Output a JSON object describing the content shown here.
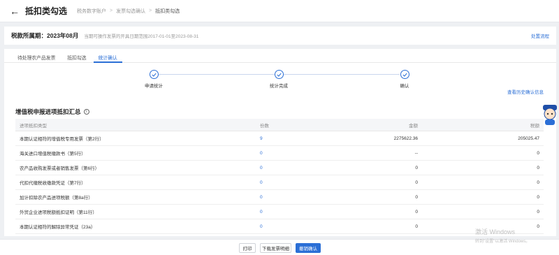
{
  "header": {
    "back_icon": "arrow-left-icon",
    "title": "抵扣类勾选",
    "breadcrumbs": [
      "税务数字账户",
      "发票勾选确认",
      "抵扣类勾选"
    ]
  },
  "period": {
    "label": "税款所属期：",
    "value": "2023年08月",
    "hint": "当期可操作发票的开具日期范围2017-01-01至2023-08-31",
    "link": "处置流程"
  },
  "tabs": [
    "待处理农产品发票",
    "抵扣勾选",
    "统计确认"
  ],
  "active_tab": 2,
  "steps": [
    "申请统计",
    "统计完成",
    "确认"
  ],
  "history_link": "查看历史确认信息",
  "section": {
    "title": "增值税申报进项抵扣汇总",
    "info_icon": "info-circle-icon"
  },
  "table": {
    "headers": [
      "进项抵扣类型",
      "份数",
      "金额",
      "税额"
    ],
    "rows": [
      [
        "本期认证相符的增值税专用发票（第2行）",
        "9",
        "2275622.36",
        "205025.47"
      ],
      [
        "海关进口增值税缴款书（第5行）",
        "0",
        "--",
        "0"
      ],
      [
        "农产品收购发票或者销售发票（第6行）",
        "0",
        "0",
        "0"
      ],
      [
        "代扣代缴税收缴款凭证（第7行）",
        "0",
        "0",
        "0"
      ],
      [
        "加计扣除农产品进项税额（第8a行）",
        "0",
        "0",
        "0"
      ],
      [
        "外贸企业进项税额抵扣证明（第11行）",
        "0",
        "0",
        "0"
      ],
      [
        "本期认证相符的解除异常凭证（23a）",
        "0",
        "0",
        "0"
      ]
    ]
  },
  "footer": {
    "print": "打印",
    "download": "下载发票明细",
    "confirm": "撤销确认"
  },
  "watermark": {
    "line1": "激活 Windows",
    "line2": "转到\"设置\"以激活 Windows。"
  },
  "colors": {
    "accent": "#2b6fd6",
    "background": "#eef0f3"
  }
}
